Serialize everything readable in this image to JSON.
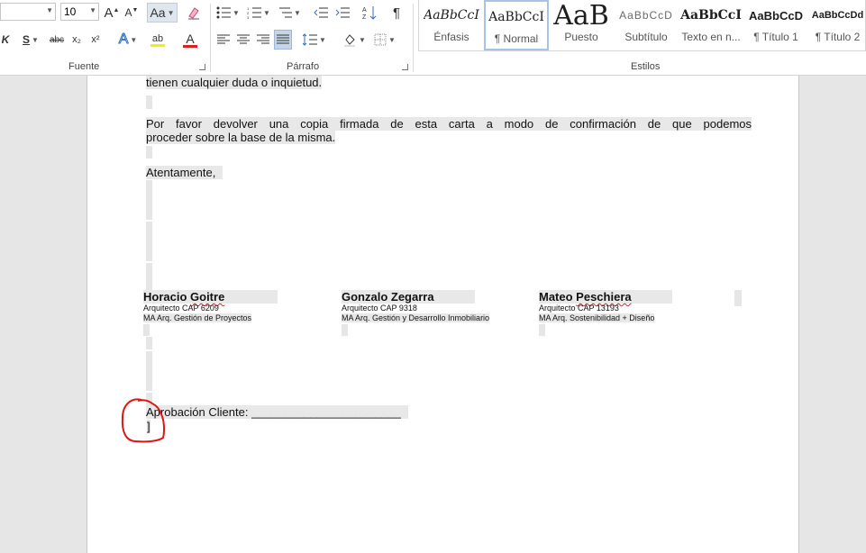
{
  "font_group": {
    "label": "Fuente",
    "font_size": "10",
    "grow_font": "A",
    "shrink_font": "A",
    "change_case": "Aa",
    "italic": "K",
    "underline": "S",
    "strikethrough": "abc",
    "subscript": "x₂",
    "superscript": "x²",
    "text_effects": "A",
    "highlight": "ab",
    "font_color": "A"
  },
  "paragraph_group": {
    "label": "Párrafo",
    "show_marks": "¶"
  },
  "styles_group": {
    "label": "Estilos",
    "items": [
      {
        "preview": "AaBbCcI",
        "name": "Énfasis"
      },
      {
        "preview": "AaBbCcI",
        "name": "¶ Normal",
        "selected": true
      },
      {
        "preview": "AaB",
        "name": "Puesto"
      },
      {
        "preview": "AaBbCcD",
        "name": "Subtítulo"
      },
      {
        "preview": "AaBbCcI",
        "name": "Texto en n..."
      },
      {
        "preview": "AaBbCcD",
        "name": "¶ Título 1"
      },
      {
        "preview": "AaBbCcDd",
        "name": "¶ Título 2"
      }
    ]
  },
  "document": {
    "line_prev": "tienen cualquier duda o inquietud.",
    "para_line1": "Por favor devolver una copia firmada de esta carta a modo de confirmación de que podemos",
    "para_line2": "proceder sobre la base de la misma.",
    "closing": "Atentamente,",
    "signatures": [
      {
        "name_first": "Horacio ",
        "name_last": "Goitre",
        "cap": "Arquitecto CAP 6209",
        "title": "MA Arq. Gestión de Proyectos"
      },
      {
        "name_first": "Gonzalo Zegarra",
        "name_last": "",
        "cap": "Arquitecto CAP 9318",
        "title": "MA Arq. Gestión y Desarrollo Inmobiliario"
      },
      {
        "name_first": "Mateo ",
        "name_last": "Peschiera",
        "cap": "Arquitecto CAP 13193",
        "title": "MA Arq. Sostenibilidad + Diseño"
      }
    ],
    "approval_label": "Aprobación Cliente: ",
    "approval_line": "_______________________",
    "cursor": "]"
  },
  "colors": {
    "font_color_bar": "#e02020",
    "highlight_bar": "#f0f000",
    "annotation_circle": "#e01515",
    "squiggle": "#d22222"
  },
  "icons": [
    "grow-font-icon",
    "shrink-font-icon",
    "clear-format-icon",
    "bullets-icon",
    "numbering-icon",
    "multilevel-icon",
    "decrease-indent-icon",
    "increase-indent-icon",
    "sort-icon",
    "pilcrow-icon",
    "align-left-icon",
    "center-icon",
    "align-right-icon",
    "justify-icon",
    "line-spacing-icon",
    "shading-icon",
    "borders-icon"
  ]
}
